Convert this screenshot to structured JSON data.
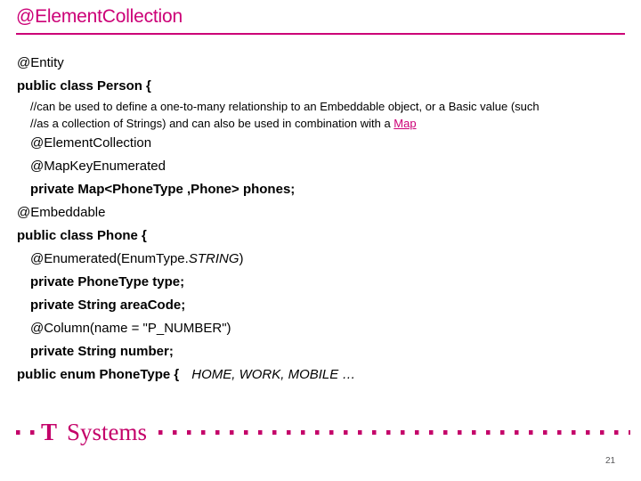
{
  "slide": {
    "title": "@ElementCollection",
    "accent_color": "#CC0077",
    "brand_color": "#C4026A"
  },
  "code": {
    "lines": [
      {
        "id": "l1",
        "text": "@Entity"
      },
      {
        "id": "l2",
        "text": "public class Person {"
      },
      {
        "id": "l3a",
        "text": "//can be used to define a one-to-many relationship to an Embeddable object, or a Basic value (such"
      },
      {
        "id": "l3b_pre",
        "text": "//as a collection of Strings) and  can also be used in combination with a "
      },
      {
        "id": "l3b_link",
        "text": "Map"
      },
      {
        "id": "l4",
        "text": "@ElementCollection"
      },
      {
        "id": "l5",
        "text": "@MapKeyEnumerated"
      },
      {
        "id": "l6",
        "text": "private Map<PhoneType ,Phone> phones;"
      },
      {
        "id": "l7",
        "text": "@Embeddable"
      },
      {
        "id": "l8",
        "text": "public class Phone {"
      },
      {
        "id": "l9_pre",
        "text": "@Enumerated(EnumType."
      },
      {
        "id": "l9_ital",
        "text": "STRING"
      },
      {
        "id": "l9_post",
        "text": ")"
      },
      {
        "id": "l10",
        "text": "private PhoneType type;"
      },
      {
        "id": "l11",
        "text": "private String areaCode;"
      },
      {
        "id": "l12",
        "text": "@Column(name = \"P_NUMBER\")"
      },
      {
        "id": "l13",
        "text": "private String number;"
      },
      {
        "id": "l14",
        "text": "public enum PhoneType {"
      },
      {
        "id": "l14_vals",
        "text": "HOME, WORK, MOBILE …"
      }
    ]
  },
  "footer": {
    "logo_mark": "T",
    "logo_word": "Systems",
    "page_number": "21"
  }
}
